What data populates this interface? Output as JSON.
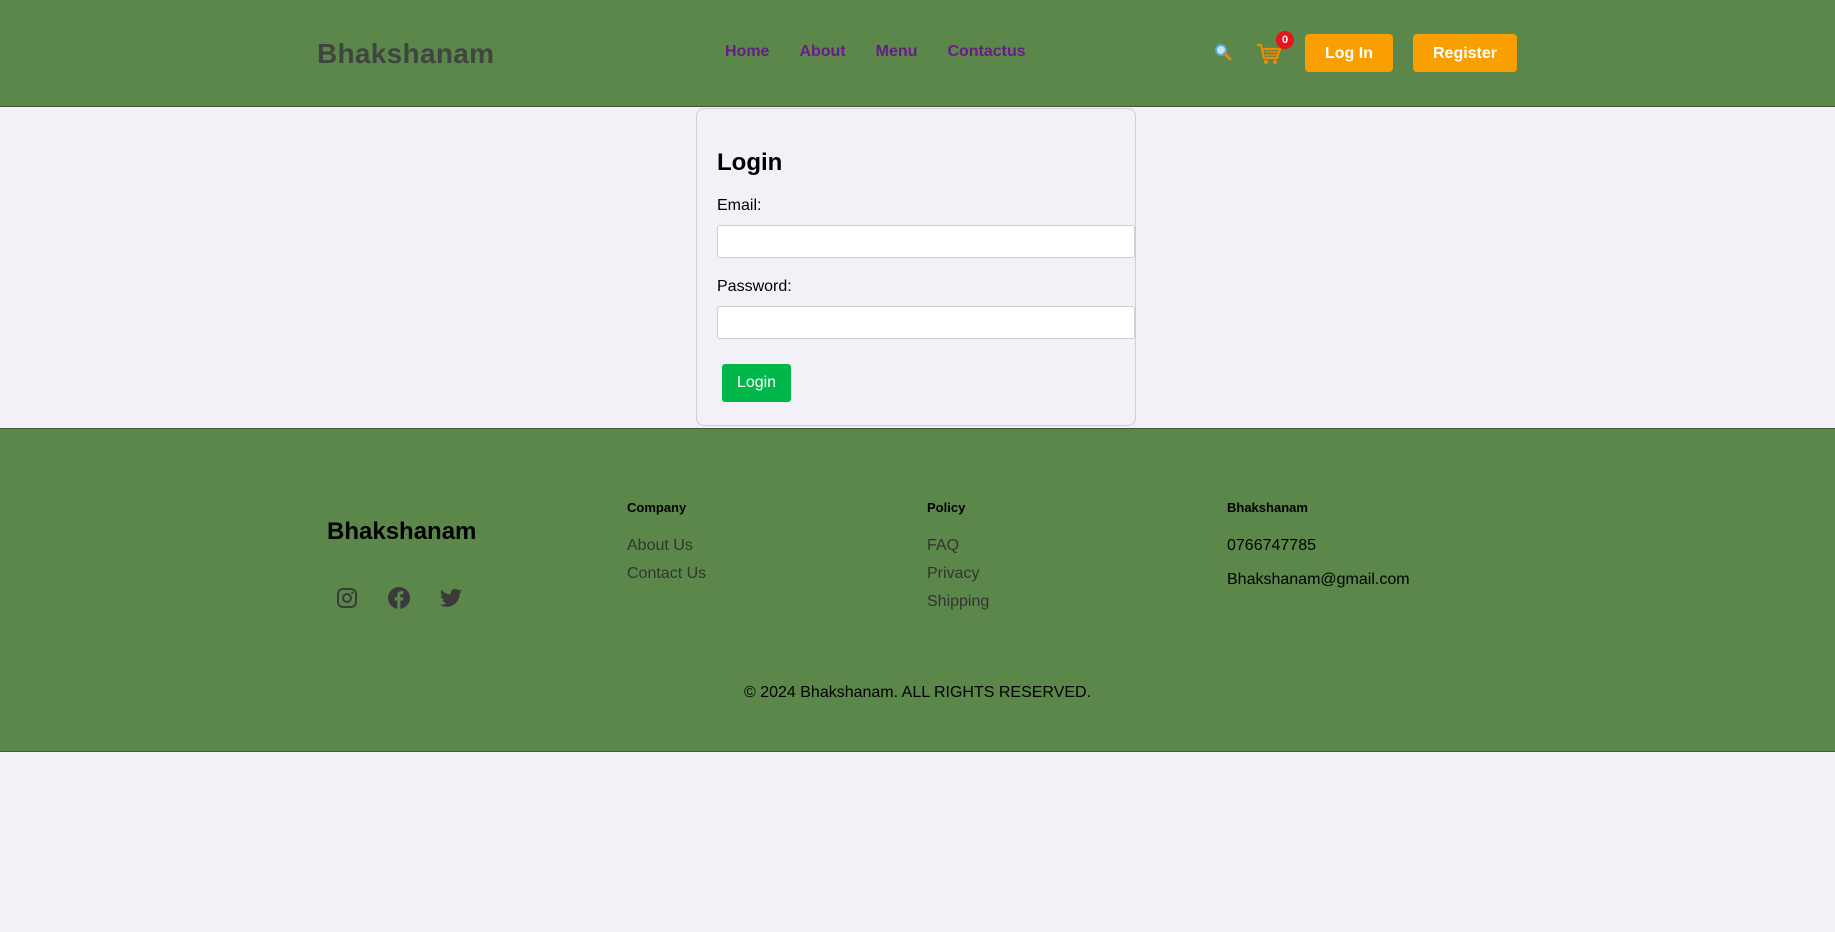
{
  "header": {
    "brand": "Bhakshanam",
    "nav": [
      "Home",
      "About",
      "Menu",
      "Contactus"
    ],
    "cart_count": "0",
    "login_label": "Log In",
    "register_label": "Register"
  },
  "login": {
    "title": "Login",
    "email_label": "Email:",
    "email_value": "",
    "password_label": "Password:",
    "password_value": "",
    "submit_label": "Login"
  },
  "footer": {
    "brand": "Bhakshanam",
    "company": {
      "title": "Company",
      "links": [
        "About Us",
        "Contact Us"
      ]
    },
    "policy": {
      "title": "Policy",
      "links": [
        "FAQ",
        "Privacy",
        "Shipping"
      ]
    },
    "contact": {
      "title": "Bhakshanam",
      "phone": "0766747785",
      "email": "Bhakshanam@gmail.com"
    },
    "copyright": "© 2024 Bhakshanam. ALL RIGHTS RESERVED."
  },
  "colors": {
    "header_bg": "#5c874a",
    "nav_link": "#6a1b8a",
    "button_orange": "#f9a000",
    "button_green": "#00b84a",
    "badge_red": "#e8141c",
    "page_bg": "#f3f0f8"
  },
  "icons": [
    "search-icon",
    "cart-icon",
    "instagram-icon",
    "facebook-icon",
    "twitter-icon"
  ]
}
